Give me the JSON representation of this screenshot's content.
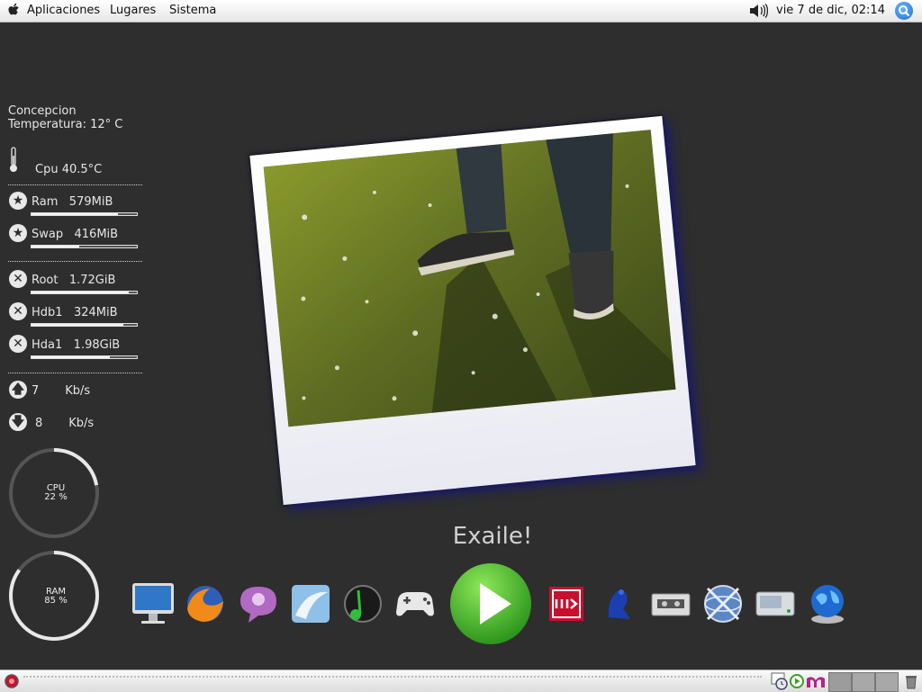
{
  "top_panel": {
    "menus": [
      "Aplicaciones",
      "Lugares",
      "Sistema"
    ],
    "clock": "vie  7 de dic, 02:14",
    "icons": [
      "apple-icon",
      "speaker-icon",
      "search-icon"
    ]
  },
  "weather": {
    "city": "Concepcion",
    "temperature": "Temperatura: 12° C"
  },
  "cpu_temp": {
    "label": "Cpu",
    "value": "40.5°C"
  },
  "memory": [
    {
      "label": "Ram",
      "value": "579MiB",
      "fill_percent": 82
    },
    {
      "label": "Swap",
      "value": "416MiB",
      "fill_percent": 45
    }
  ],
  "disks": [
    {
      "label": "Root",
      "value": "1.72GiB",
      "fill_percent": 92
    },
    {
      "label": "Hdb1",
      "value": "324MiB",
      "fill_percent": 87
    },
    {
      "label": "Hda1",
      "value": "1.98GiB",
      "fill_percent": 74
    }
  ],
  "network": {
    "up": {
      "value": "7",
      "unit": "Kb/s"
    },
    "down": {
      "value": "8",
      "unit": "Kb/s"
    }
  },
  "gauges": {
    "cpu": {
      "label": "CPU",
      "value": "22 %",
      "percent": 22
    },
    "ram": {
      "label": "RAM",
      "value": "85 %",
      "percent": 85
    }
  },
  "app_title": "Exaile!",
  "dock_icons": [
    "imac-icon",
    "firefox-icon",
    "pidgin-icon",
    "openoffice-icon",
    "music-player-icon",
    "gamepad-icon",
    "play-icon",
    "mib-icon",
    "frog-icon",
    "cassette-icon",
    "network-globe-icon",
    "drive-icon",
    "globe-icon"
  ],
  "colors": {
    "background": "#2e2e2e",
    "accent_green": "#2eaa1e",
    "polaroid_shadow": "#1a1a6a"
  }
}
